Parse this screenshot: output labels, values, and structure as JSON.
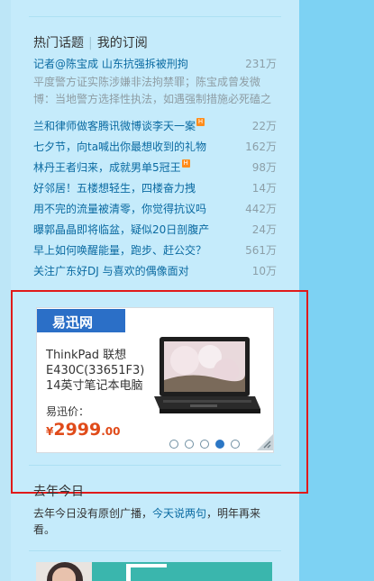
{
  "hot_topics": {
    "tab_hot": "热门话题",
    "tab_separator": "|",
    "tab_subscribed": "我的订阅",
    "items": [
      {
        "title": "记者@陈宝成 山东抗强拆被刑拘",
        "count": "231万",
        "hot": false
      },
      {
        "title": "兰和律师做客腾讯微博谈李天一案",
        "count": "22万",
        "hot": true
      },
      {
        "title": "七夕节，向ta喊出你最想收到的礼物",
        "count": "162万",
        "hot": false
      },
      {
        "title": "林丹王者归来，成就男单5冠王",
        "count": "98万",
        "hot": true
      },
      {
        "title": "好邻居！五楼想轻生，四楼奋力拽",
        "count": "14万",
        "hot": false
      },
      {
        "title": "用不完的流量被清零，你觉得抗议吗",
        "count": "442万",
        "hot": false
      },
      {
        "title": "曝郭晶晶即将临盆，疑似20日剖腹产",
        "count": "24万",
        "hot": false
      },
      {
        "title": "早上如何唤醒能量，跑步、赶公交？",
        "count": "561万",
        "hot": false
      },
      {
        "title": "关注广东好DJ 与喜欢的偶像面对",
        "count": "10万",
        "hot": false
      }
    ],
    "snippet": "平度警方证实陈涉嫌非法拘禁罪；陈宝成曾发微博：当地警方选择性执法，如遇强制措施必死磕之",
    "hot_badge": "H"
  },
  "ad": {
    "logo": "易迅网",
    "product_title": "ThinkPad 联想 E430C(33651F3) 14英寸笔记本电脑",
    "price_label": "易迅价：",
    "currency": "¥",
    "price_int": "2999",
    "price_dec": ".00",
    "dots_count": 5,
    "active_dot": 3
  },
  "today": {
    "title": "去年今日",
    "text_before": "去年今日没有原创广播，",
    "link": "今天说两句",
    "text_after": "，明年再来看。"
  },
  "colors": {
    "link": "#0a6aa1",
    "count": "#8c9fa8",
    "price": "#e04b1a",
    "highlight_border": "#e01a1a",
    "logo_bg": "#2b6fc7"
  }
}
